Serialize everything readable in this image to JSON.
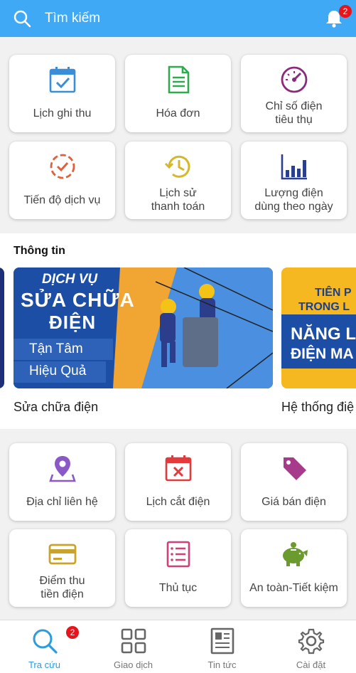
{
  "header": {
    "search_placeholder": "Tìm kiếm",
    "notification_count": "2"
  },
  "top_grid": [
    {
      "label": "Lịch ghi thu",
      "icon": "calendar-check-icon"
    },
    {
      "label": "Hóa đơn",
      "icon": "invoice-icon"
    },
    {
      "label": "Chỉ số điện\ntiêu thụ",
      "icon": "gauge-icon"
    },
    {
      "label": "Tiến độ dịch vụ",
      "icon": "progress-check-icon"
    },
    {
      "label": "Lịch sử\nthanh toán",
      "icon": "history-icon"
    },
    {
      "label": "Lượng điện\ndùng theo ngày",
      "icon": "bar-chart-icon"
    }
  ],
  "info": {
    "title": "Thông tin",
    "banners": [
      {
        "caption": "Sửa chữa điện",
        "line1": "DỊCH VỤ",
        "line2": "SỬA CHỮA",
        "line3": "ĐIỆN",
        "tag1": "Tận Tâm",
        "tag2": "Hiệu Quả"
      },
      {
        "caption": "Hệ thống điệ",
        "line1": "TIÊN P",
        "line2": "TRONG L",
        "line3": "NĂNG L",
        "line4": "ĐIỆN MA"
      }
    ]
  },
  "bottom_grid": [
    {
      "label": "Địa chỉ liên hệ",
      "icon": "location-pin-icon"
    },
    {
      "label": "Lịch cắt điện",
      "icon": "calendar-x-icon"
    },
    {
      "label": "Giá bán điện",
      "icon": "price-tag-icon"
    },
    {
      "label": "Điểm thu\ntiền điện",
      "icon": "card-icon"
    },
    {
      "label": "Thủ tục",
      "icon": "document-list-icon"
    },
    {
      "label": "An toàn-Tiết kiệm",
      "icon": "piggy-bank-icon"
    }
  ],
  "nav": {
    "items": [
      {
        "label": "Tra cứu",
        "icon": "search-icon",
        "active": true
      },
      {
        "label": "Giao dịch",
        "icon": "grid-icon"
      },
      {
        "label": "Tin tức",
        "icon": "newspaper-icon"
      },
      {
        "label": "Cài đặt",
        "icon": "gear-icon"
      }
    ],
    "badge": "2"
  },
  "colors": {
    "header_bg": "#3fa9f5",
    "accent": "#2d9cdb",
    "badge": "#e8141c"
  }
}
